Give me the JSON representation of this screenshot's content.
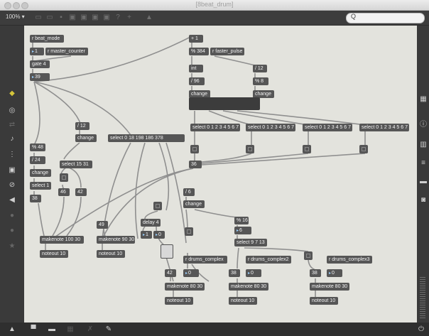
{
  "window": {
    "title": "[8beat_drum]"
  },
  "toolbar": {
    "zoom": "100% ▾",
    "search_glyph": "Q"
  },
  "objects": {
    "r_beat_mode": "r beat_mode",
    "num_1": "1",
    "r_master_counter": "r master_counter",
    "gate4": "gate 4",
    "num_39": "39",
    "plus1": "+ 1",
    "mod384": "% 384",
    "r_faster_pulse": "r faster_pulse",
    "int": "int",
    "div12_top": "/ 12",
    "div96": "/ 96",
    "mod8": "% 8",
    "change_a": "change",
    "change_b": "change",
    "select1": "select 0 1 2 3 4 5 6 7",
    "select2": "select 0 1 2 3 4 5 6 7",
    "select3": "select 0 1 2 3 4 5 6 7",
    "select4": "select 0 1 2 3 4 5 6 7",
    "num_36_mid": "36",
    "div12_left": "/ 12",
    "change_left": "change",
    "select_big": "select 0 18 198 186 378",
    "mod48": "% 48",
    "div24": "/ 24",
    "change_l2": "change",
    "select_15_31": "select 15 31",
    "select_1": "select 1",
    "num_46": "46",
    "num_42a": "42",
    "num_38a": "38",
    "div6": "/ 6",
    "change_mid": "change",
    "num_49": "49",
    "delay4": "delay 4",
    "num_1b": "1",
    "num_0a": "0",
    "mod16": "% 16",
    "num_6": "6",
    "select_9_7_13": "select 9 7 13",
    "makenote_100": "makenote 100 30",
    "makenote_90": "makenote 90 30",
    "noteout_a": "noteout 10",
    "noteout_b": "noteout 10",
    "r_drums_complex": "r drums_complex",
    "r_drums_complex2": "r drums_complex2",
    "r_drums_complex3": "r drums_complex3",
    "num_0b": "0",
    "num_0c": "0",
    "num_0d": "0",
    "num_42b": "42",
    "num_38b": "38",
    "num_38c": "38",
    "makenote_80a": "makenote 80 30",
    "makenote_80b": "makenote 80 30",
    "makenote_80c": "makenote 80 30",
    "noteout_c": "noteout 10",
    "noteout_d": "noteout 10",
    "noteout_e": "noteout 10"
  }
}
